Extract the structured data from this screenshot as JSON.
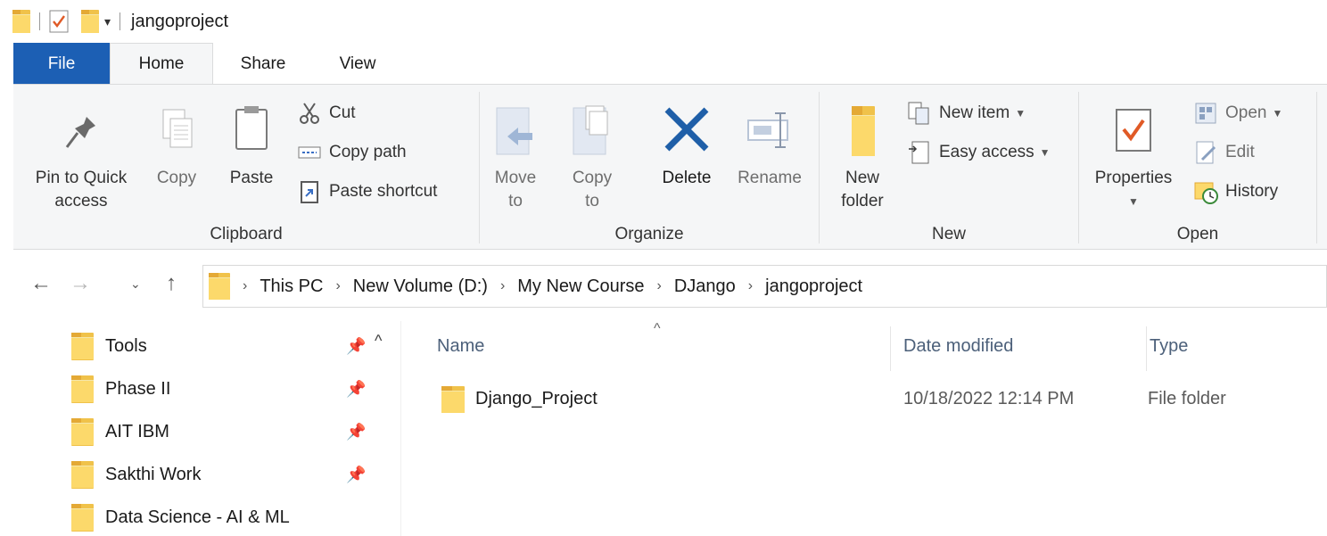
{
  "window": {
    "title": "jangoproject",
    "qat_dropdown": "▾"
  },
  "tabs": [
    {
      "label": "File"
    },
    {
      "label": "Home"
    },
    {
      "label": "Share"
    },
    {
      "label": "View"
    }
  ],
  "ribbon": {
    "clipboard": {
      "label": "Clipboard",
      "pin": "Pin to Quick\naccess",
      "copy": "Copy",
      "paste": "Paste",
      "cut": "Cut",
      "copy_path": "Copy path",
      "paste_shortcut": "Paste shortcut"
    },
    "organize": {
      "label": "Organize",
      "move_to": "Move\nto",
      "copy_to": "Copy\nto",
      "delete": "Delete",
      "rename": "Rename"
    },
    "new": {
      "label": "New",
      "new_folder": "New\nfolder",
      "new_item": "New item",
      "easy_access": "Easy access"
    },
    "open": {
      "label": "Open",
      "properties": "Properties",
      "open": "Open",
      "edit": "Edit",
      "history": "History"
    }
  },
  "address": {
    "crumbs": [
      "This PC",
      "New Volume (D:)",
      "My New Course",
      "DJango",
      "jangoproject"
    ]
  },
  "nav_pane": {
    "items": [
      {
        "label": "Tools",
        "pinned": true
      },
      {
        "label": "Phase II",
        "pinned": true
      },
      {
        "label": "AIT IBM",
        "pinned": true
      },
      {
        "label": "Sakthi Work",
        "pinned": true
      },
      {
        "label": "Data Science - AI & ML",
        "pinned": false
      }
    ]
  },
  "columns": {
    "name": "Name",
    "date": "Date modified",
    "type": "Type"
  },
  "files": [
    {
      "name": "Django_Project",
      "date": "10/18/2022 12:14 PM",
      "type": "File folder"
    }
  ],
  "colors": {
    "file_tab": "#1c5fb4",
    "ribbon_bg": "#f5f6f7",
    "folder": "#fcd96b"
  }
}
